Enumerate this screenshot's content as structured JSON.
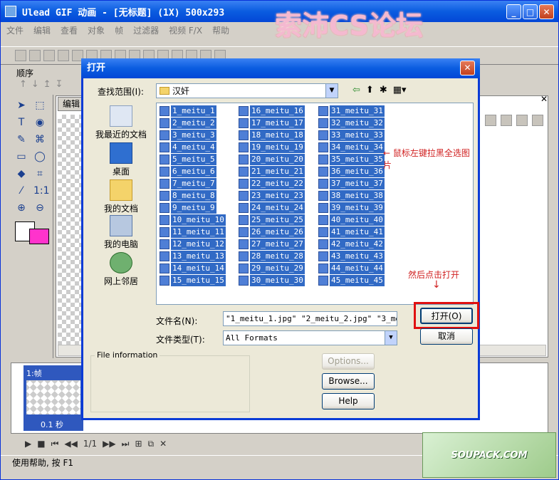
{
  "app": {
    "title": "Ulead GIF 动画 - [无标题] (1X) 500x293",
    "watermark": "索沛CS论坛",
    "menu": [
      "文件",
      "编辑",
      "查看",
      "对象",
      "帧",
      "过滤器",
      "视频 F/X",
      "帮助"
    ],
    "order_label": "顺序",
    "edit_tab": "编辑",
    "frame_label": "1:帧",
    "frame_delay": "0.1 秒",
    "page_counter": "1/1",
    "status": "使用帮助, 按 F1",
    "corner_logo": "SOUPACK.COM"
  },
  "dialog": {
    "title": "打开",
    "look_in_label": "查找范围(I):",
    "look_in_value": "汉奸",
    "places": [
      "我最近的文档",
      "桌面",
      "我的文档",
      "我的电脑",
      "网上邻居"
    ],
    "files_col1": [
      "1_meitu_1",
      "2_meitu_2",
      "3_meitu_3",
      "4_meitu_4",
      "5_meitu_5",
      "6_meitu_6",
      "7_meitu_7",
      "8_meitu_8",
      "9_meitu_9",
      "10_meitu_10",
      "11_meitu_11",
      "12_meitu_12",
      "13_meitu_13",
      "14_meitu_14",
      "15_meitu_15"
    ],
    "files_col2": [
      "16_meitu_16",
      "17_meitu_17",
      "18_meitu_18",
      "19_meitu_19",
      "20_meitu_20",
      "21_meitu_21",
      "22_meitu_22",
      "23_meitu_23",
      "24_meitu_24",
      "25_meitu_25",
      "26_meitu_26",
      "27_meitu_27",
      "28_meitu_28",
      "29_meitu_29",
      "30_meitu_30"
    ],
    "files_col3": [
      "31_meitu_31",
      "32_meitu_32",
      "33_meitu_33",
      "34_meitu_34",
      "35_meitu_35",
      "36_meitu_36",
      "37_meitu_37",
      "38_meitu_38",
      "39_meitu_39",
      "40_meitu_40",
      "41_meitu_41",
      "42_meitu_42",
      "43_meitu_43",
      "44_meitu_44",
      "45_meitu_45"
    ],
    "annotation_select": "鼠标左键拉黑全选图片",
    "annotation_open": "然后点击打开",
    "filename_label": "文件名(N):",
    "filename_value": "\"1_meitu_1.jpg\" \"2_meitu_2.jpg\" \"3_me",
    "filetype_label": "文件类型(T):",
    "filetype_value": "All Formats",
    "open_button": "打开(O)",
    "cancel_button": "取消",
    "file_info_label": "File information",
    "options_button": "Options...",
    "browse_button": "Browse...",
    "help_button": "Help"
  }
}
